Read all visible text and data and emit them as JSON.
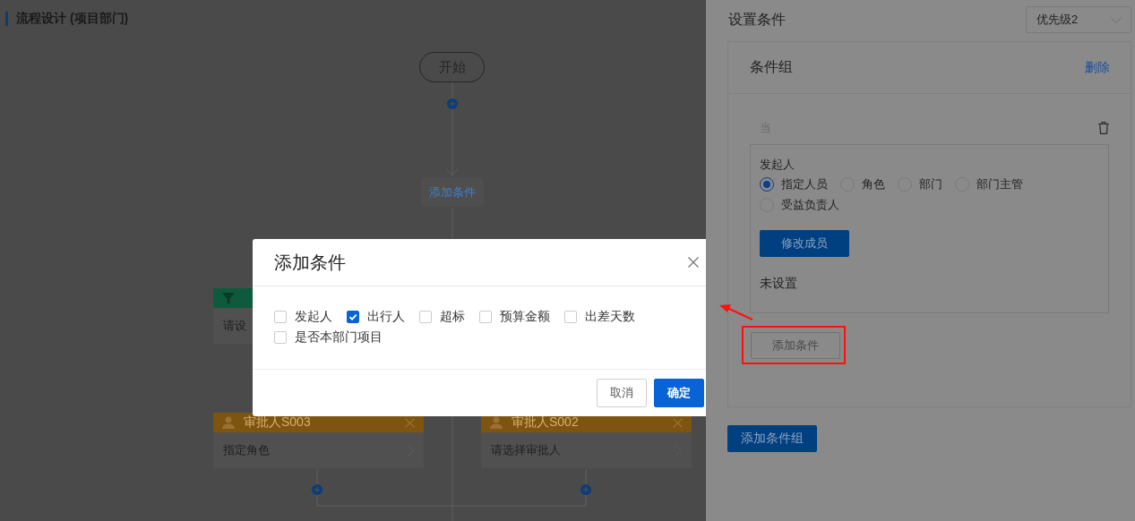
{
  "page": {
    "title": "流程设计 (项目部门)"
  },
  "flow": {
    "start": "开始",
    "add_condition": "添加条件",
    "condition_card": {
      "body": "请设"
    },
    "approvers": [
      {
        "title": "审批人S003",
        "body": "指定角色"
      },
      {
        "title": "审批人S002",
        "body": "请选择审批人"
      }
    ]
  },
  "drawer": {
    "title": "设置条件",
    "priority_select": {
      "value": "优先级2"
    },
    "group": {
      "title": "条件组",
      "delete": "删除",
      "when": "当",
      "condition": {
        "label": "发起人",
        "options": [
          {
            "label": "指定人员",
            "selected": true
          },
          {
            "label": "角色",
            "selected": false
          },
          {
            "label": "部门",
            "selected": false
          },
          {
            "label": "部门主管",
            "selected": false
          },
          {
            "label": "受益负责人",
            "selected": false
          }
        ],
        "button": "修改成员",
        "value": "未设置"
      },
      "add_condition": "添加条件"
    },
    "add_group": "添加条件组"
  },
  "dialog": {
    "title": "添加条件",
    "options": [
      {
        "label": "发起人",
        "checked": false
      },
      {
        "label": "出行人",
        "checked": true
      },
      {
        "label": "超标",
        "checked": false
      },
      {
        "label": "预算金额",
        "checked": false
      },
      {
        "label": "出差天数",
        "checked": false
      },
      {
        "label": "是否本部门项目",
        "checked": false
      }
    ],
    "buttons": [
      {
        "label": "取消",
        "kind": "secondary"
      },
      {
        "label": "确定",
        "kind": "primary"
      }
    ]
  }
}
